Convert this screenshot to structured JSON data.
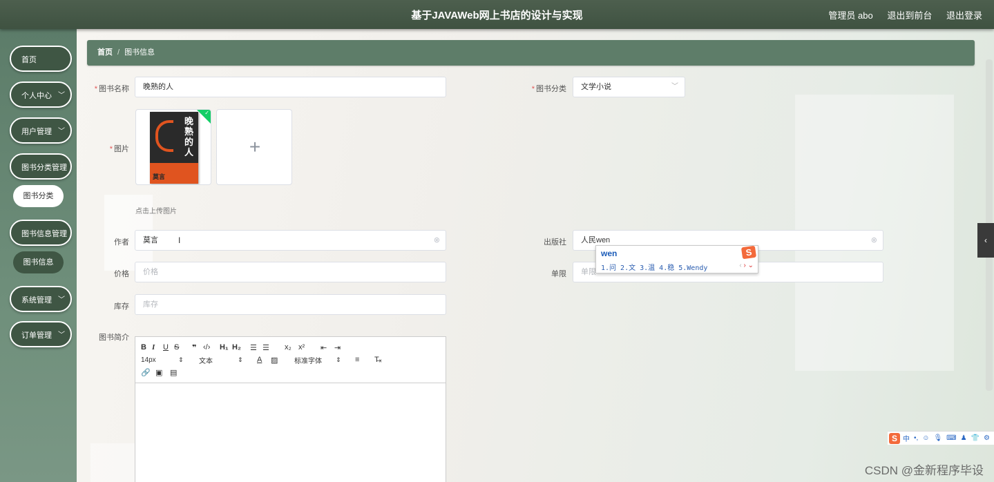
{
  "header": {
    "title": "基于JAVAWeb网上书店的设计与实现",
    "user_label": "管理员 abo",
    "front_label": "退出到前台",
    "logout_label": "退出登录"
  },
  "sidebar": {
    "items": [
      {
        "label": "首页",
        "has_arrow": false
      },
      {
        "label": "个人中心",
        "has_arrow": true
      },
      {
        "label": "用户管理",
        "has_arrow": true
      },
      {
        "label": "图书分类管理",
        "has_arrow": true
      },
      {
        "label": "图书信息管理",
        "has_arrow": true
      },
      {
        "label": "系统管理",
        "has_arrow": true
      },
      {
        "label": "订单管理",
        "has_arrow": true
      }
    ],
    "subitems": {
      "category": "图书分类",
      "info": "图书信息"
    }
  },
  "breadcrumb": {
    "home": "首页",
    "separator": "/",
    "current": "图书信息"
  },
  "form": {
    "name": {
      "label": "图书名称",
      "value": "晚熟的人"
    },
    "category": {
      "label": "图书分类",
      "value": "文学小说"
    },
    "image": {
      "label": "图片",
      "hint": "点击上传图片",
      "book_title": "晚熟的人",
      "book_author": "莫言",
      "plus": "+"
    },
    "author": {
      "label": "作者",
      "value": "莫言"
    },
    "publisher": {
      "label": "出版社",
      "value": "人民wen"
    },
    "price": {
      "label": "价格",
      "placeholder": "价格"
    },
    "unit": {
      "label": "单限",
      "placeholder": "单限"
    },
    "stock": {
      "label": "库存",
      "placeholder": "库存"
    },
    "intro": {
      "label": "图书简介"
    }
  },
  "editor": {
    "font_size": "14px",
    "block_type": "文本",
    "font_family": "标准字体"
  },
  "ime": {
    "typed": "wen",
    "candidates": "1.问  2.文  3.温  4.稳  5.Wendy",
    "bar": "中"
  },
  "watermark": "CSDN @金新程序毕设",
  "colors": {
    "header": "#45584a",
    "sidebar_pill": "#3f5644",
    "breadcrumb": "#5e7d69",
    "required": "#e25555",
    "success_badge": "#13ce66"
  }
}
